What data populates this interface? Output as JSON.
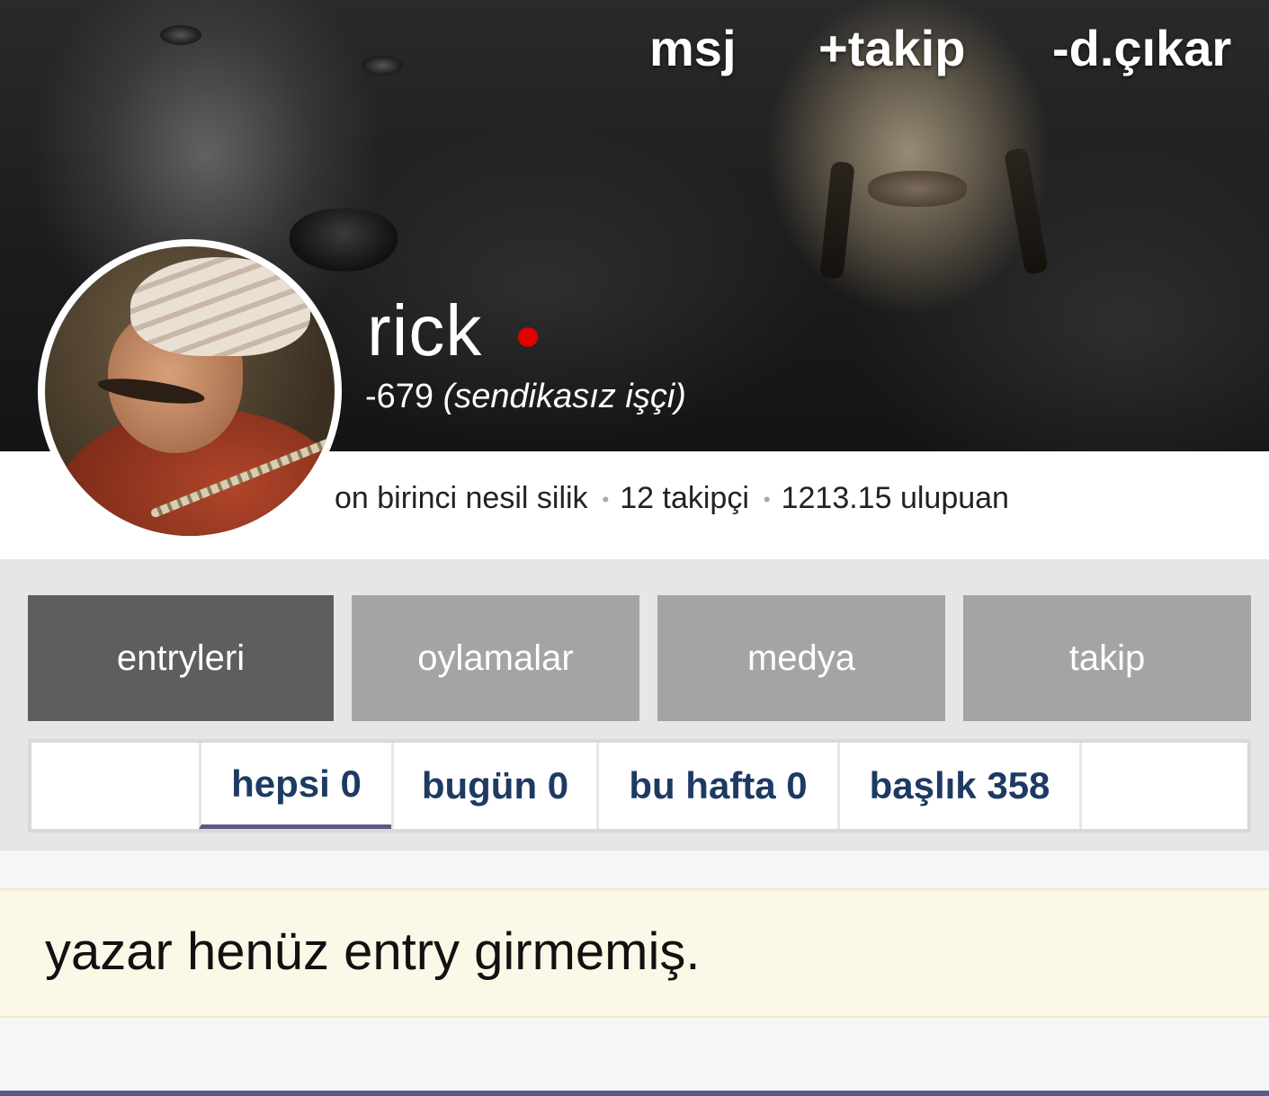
{
  "header": {
    "actions": {
      "message": "msj",
      "follow": "+takip",
      "block": "-d.çıkar"
    },
    "user": {
      "name": "rick",
      "karma_score": "-679",
      "karma_title": "(sendikasız işçi)",
      "online_status_color": "#e00000"
    }
  },
  "stats": {
    "generation": "on birinci nesil silik",
    "followers": "12 takipçi",
    "points": "1213.15 ulupuan"
  },
  "main_tabs": [
    {
      "label": "entryleri",
      "active": true
    },
    {
      "label": "oylamalar",
      "active": false
    },
    {
      "label": "medya",
      "active": false
    },
    {
      "label": "takip",
      "active": false
    }
  ],
  "sub_tabs": [
    {
      "label": "hepsi 0",
      "active": true
    },
    {
      "label": "bugün 0",
      "active": false
    },
    {
      "label": "bu hafta 0",
      "active": false
    },
    {
      "label": "başlık 358",
      "active": false
    }
  ],
  "notice": {
    "text": "yazar henüz entry girmemiş."
  },
  "colors": {
    "active_tab": "#5e5e5e",
    "inactive_tab": "#a4a4a4",
    "sub_tab_text": "#1d3a63",
    "accent_underline": "#5b5a86",
    "notice_bg": "#fcf8e8"
  }
}
